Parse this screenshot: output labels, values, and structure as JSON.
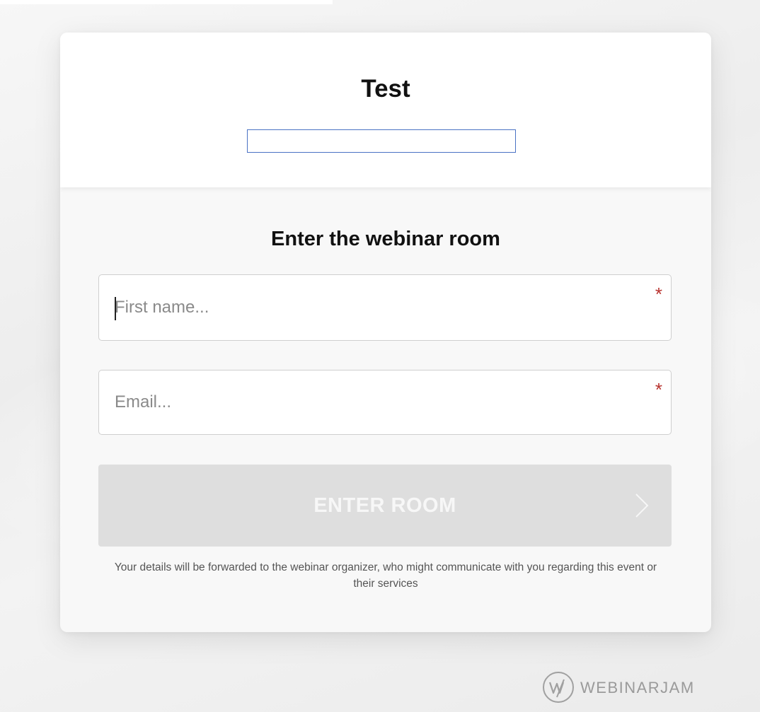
{
  "header": {
    "event_title": "Test"
  },
  "form": {
    "title": "Enter the webinar room",
    "first_name": {
      "value": "",
      "placeholder": "First name...",
      "required_mark": "*"
    },
    "email": {
      "value": "",
      "placeholder": "Email...",
      "required_mark": "*"
    },
    "submit_label": "ENTER ROOM",
    "submit_icon": "chevron-right-icon",
    "disclaimer": "Your details will be forwarded to the webinar organizer, who might communicate with you regarding this event or their services"
  },
  "brand": {
    "name": "WEBINARJAM",
    "logo_icon": "webinarjam-logo-icon"
  },
  "colors": {
    "required_mark": "#b8322e",
    "highlight_border": "#4a72c4",
    "button_disabled": "#dedede"
  }
}
